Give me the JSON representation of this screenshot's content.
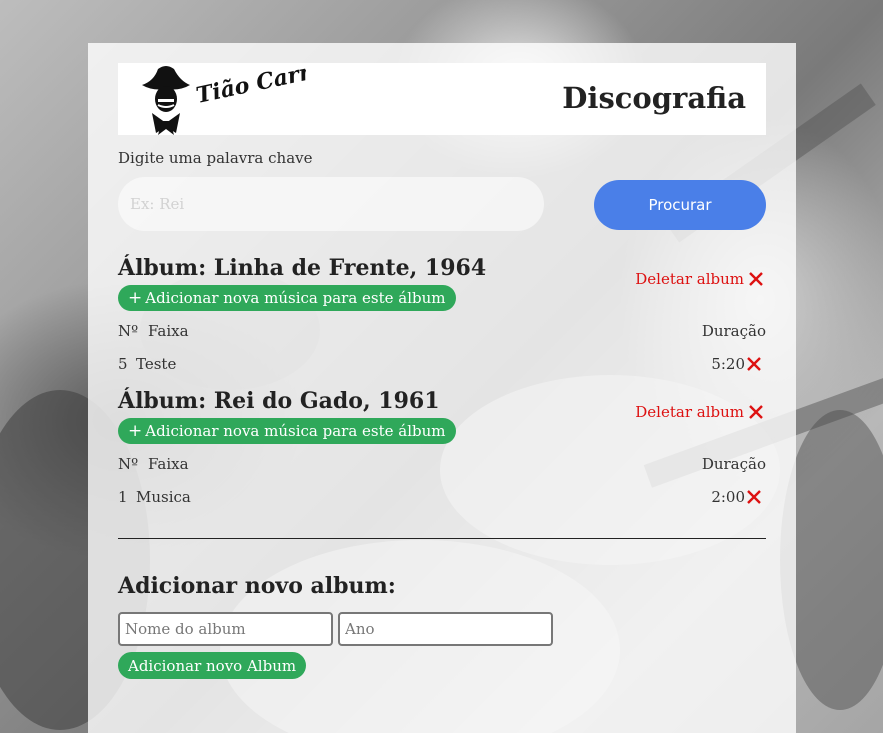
{
  "header": {
    "logo_text": "Tião Carreiro",
    "title": "Discografia"
  },
  "search": {
    "label": "Digite uma palavra chave",
    "placeholder": "Ex: Rei",
    "value": "",
    "button_label": "Procurar"
  },
  "albums": [
    {
      "title": "Álbum: Linha de Frente, 1964",
      "add_track_label": "Adicionar nova música para este álbum",
      "delete_label": "Deletar album",
      "col_num": "Nº",
      "col_track": "Faixa",
      "col_duration": "Duração",
      "tracks": [
        {
          "num": "5",
          "name": "Teste",
          "duration": "5:20"
        }
      ]
    },
    {
      "title": "Álbum: Rei do Gado, 1961",
      "add_track_label": "Adicionar nova música para este álbum",
      "delete_label": "Deletar album",
      "col_num": "Nº",
      "col_track": "Faixa",
      "col_duration": "Duração",
      "tracks": [
        {
          "num": "1",
          "name": "Musica",
          "duration": "2:00"
        }
      ]
    }
  ],
  "new_album": {
    "title": "Adicionar novo album:",
    "name_placeholder": "Nome do album",
    "year_placeholder": "Ano",
    "button_label": "Adicionar novo Album"
  },
  "icons": {
    "delete": "close-x-icon",
    "add": "plus-icon",
    "logo": "cowboy-logo-icon"
  },
  "colors": {
    "primary_button": "#4a7fe8",
    "add_button": "#2fa85a",
    "delete": "#dd1111"
  }
}
